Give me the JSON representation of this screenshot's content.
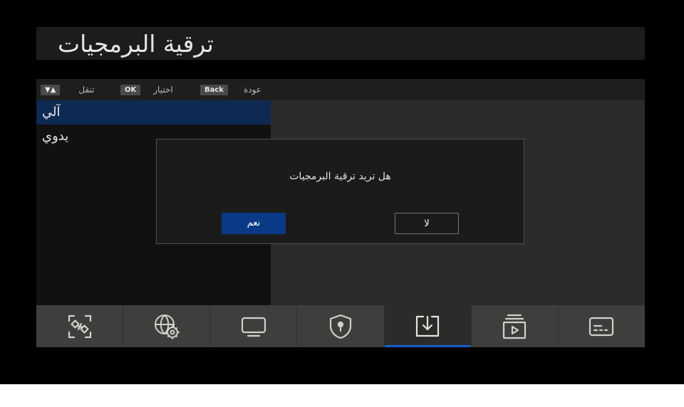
{
  "header": {
    "title": "ترقية البرمجيات"
  },
  "hints": {
    "nav_key": "▼▲",
    "nav_label": "تنقل",
    "ok_key": "OK",
    "ok_label": "اختيار",
    "back_key": "Back",
    "back_label": "عودة"
  },
  "list": {
    "items": [
      {
        "label": "آلي",
        "selected": true
      },
      {
        "label": "يدوي",
        "selected": false
      }
    ]
  },
  "dialog": {
    "message": "هل تريد ترقية البرمجيات",
    "yes_label": "نعم",
    "no_label": "لا"
  },
  "icon_bar": {
    "items": [
      {
        "icon": "satellite-icon"
      },
      {
        "icon": "network-settings-icon"
      },
      {
        "icon": "tv-icon"
      },
      {
        "icon": "parental-lock-shield-icon"
      },
      {
        "icon": "software-download-icon",
        "active": true
      },
      {
        "icon": "media-player-icon"
      },
      {
        "icon": "subtitle-info-icon"
      }
    ]
  },
  "colors": {
    "selection": "#0e2a52",
    "primary_button": "#0a3a86",
    "active_underline": "#1a5cc8"
  }
}
